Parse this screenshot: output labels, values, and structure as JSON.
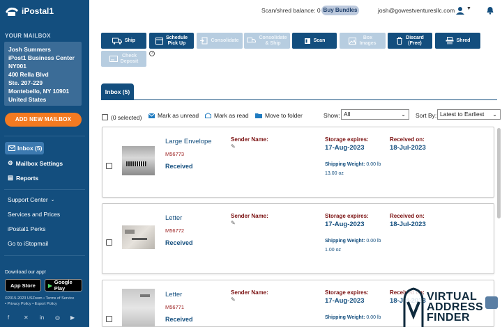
{
  "app": {
    "logo_text": "iPostal1"
  },
  "sidebar": {
    "section_label": "YOUR MAILBOX",
    "address_lines": [
      "Josh Summers",
      "iPost1 Business Center",
      "NY001",
      "400 Rella Blvd",
      "Ste. 207-229",
      "Montebello, NY 10901",
      "United States"
    ],
    "add_mailbox": "ADD NEW MAILBOX",
    "inbox": "Inbox (5)",
    "mailbox_settings": "Mailbox Settings",
    "reports": "Reports",
    "support_center": "Support Center",
    "services_prices": "Services and Prices",
    "perks": "iPostal1 Perks",
    "istopmail": "Go to iStopmail",
    "download": "Download our app!",
    "app_store": "App Store",
    "google_play": "Google Play",
    "copyright": "©2015-2023 USZoom  •  Terms of Service",
    "policies": "•  Privacy Policy  •  Export Policy"
  },
  "topbar": {
    "balance": "Scan/shred balance: 0",
    "buy_bundles": "Buy Bundles",
    "email": "josh@gowestventuresllc.com"
  },
  "toolbar": {
    "ship": "Ship",
    "schedule_line1": "Schedule",
    "schedule_line2": "Pick Up",
    "consolidate": "Consolidate",
    "consolidate_ship_line1": "Consolidate",
    "consolidate_ship_line2": "& Ship",
    "scan": "Scan",
    "box_images_line1": "Box",
    "box_images_line2": "Images",
    "discard_line1": "Discard",
    "discard_line2": "(Free)",
    "shred": "Shred",
    "check_deposit_line1": "Check",
    "check_deposit_line2": "Deposit",
    "help": "?"
  },
  "tabs": {
    "inbox": "Inbox (5)"
  },
  "actions": {
    "selected": "(0 selected)",
    "mark_unread": "Mark as unread",
    "mark_read": "Mark as read",
    "move_folder": "Move to folder",
    "show_label": "Show:",
    "show_value": "All",
    "sort_label": "Sort By:",
    "sort_value": "Latest to Earliest"
  },
  "labels": {
    "sender": "Sender Name:",
    "storage": "Storage expires:",
    "received_on": "Received on:",
    "shipping_weight": "Shipping Weight:"
  },
  "items": [
    {
      "type": "Large Envelope",
      "id": "M56773",
      "status": "Received",
      "storage": "17-Aug-2023",
      "received": "18-Jul-2023",
      "weight_lb": "0.00 lb",
      "weight_oz": "13.00 oz"
    },
    {
      "type": "Letter",
      "id": "M56772",
      "status": "Received",
      "storage": "17-Aug-2023",
      "received": "18-Jul-2023",
      "weight_lb": "0.00 lb",
      "weight_oz": "1.00 oz"
    },
    {
      "type": "Letter",
      "id": "M56771",
      "status": "Received",
      "storage": "17-Aug-2023",
      "received": "18-Jul-2023",
      "weight_lb": "0.00 lb",
      "weight_oz": ""
    }
  ],
  "watermark": {
    "line1": "VIRTUAL",
    "line2": "ADDRESS",
    "line3": "FINDER"
  },
  "colors": {
    "brand": "#134e7e",
    "accent": "#f37a21",
    "date": "#134e7e",
    "label": "#7a1010"
  }
}
